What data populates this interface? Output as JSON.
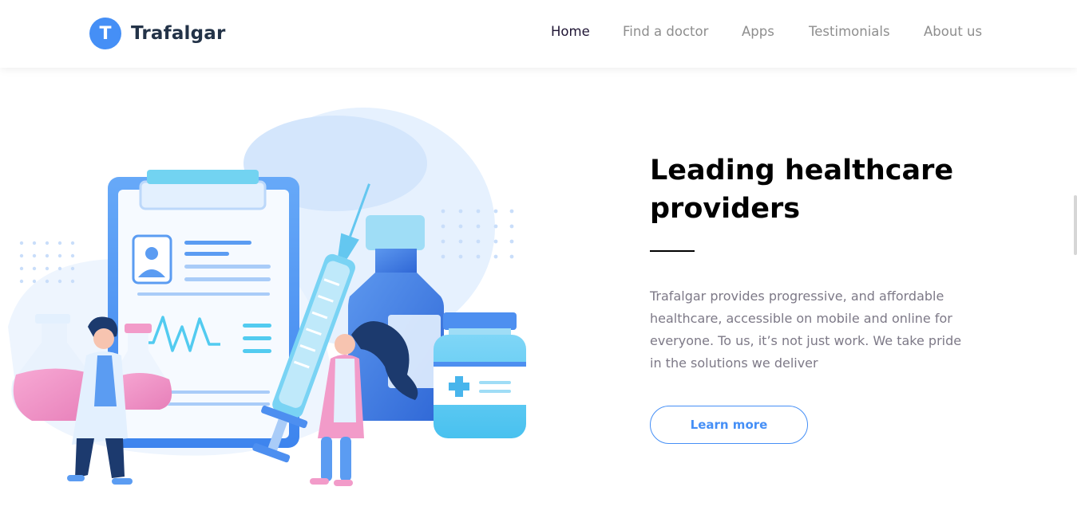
{
  "brand": {
    "logo_letter": "T",
    "name": "Trafalgar",
    "color": "#458FF6"
  },
  "nav": {
    "items": [
      {
        "label": "Home",
        "active": true
      },
      {
        "label": "Find a doctor",
        "active": false
      },
      {
        "label": "Apps",
        "active": false
      },
      {
        "label": "Testimonials",
        "active": false
      },
      {
        "label": "About us",
        "active": false
      }
    ]
  },
  "hero": {
    "title_line1": "Leading healthcare",
    "title_line2": "providers",
    "description": "Trafalgar provides progressive, and affordable healthcare, accessible on mobile and online for everyone. To us, it’s not just work. We take pride in the solutions we deliver",
    "cta_label": "Learn more"
  },
  "illustration": {
    "description_icon": "medical-illustration",
    "colors": {
      "primary": "#458FF6",
      "pink": "#F29BC9",
      "light": "#E3F0FE"
    }
  }
}
